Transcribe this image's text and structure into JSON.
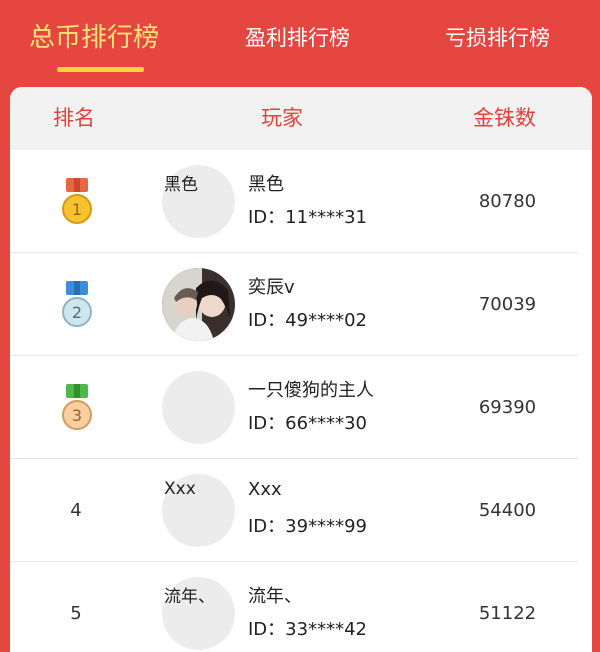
{
  "tabs": [
    {
      "label": "总币排行榜",
      "active": true
    },
    {
      "label": "盈利排行榜",
      "active": false
    },
    {
      "label": "亏损排行榜",
      "active": false
    }
  ],
  "table": {
    "headers": {
      "rank": "排名",
      "player": "玩家",
      "coins": "金铢数"
    },
    "rows": [
      {
        "rank": "1",
        "medal": "gold-medal-icon",
        "avatar_text": "黑色",
        "name": "黑色",
        "id": "ID：11****31",
        "coins": "80780"
      },
      {
        "rank": "2",
        "medal": "silver-medal-icon",
        "avatar_text": "",
        "name": "奕辰v",
        "id": "ID：49****02",
        "coins": "70039"
      },
      {
        "rank": "3",
        "medal": "bronze-medal-icon",
        "avatar_text": "",
        "name": "一只傻狗的主人",
        "id": "ID：66****30",
        "coins": "69390"
      },
      {
        "rank": "4",
        "medal": "",
        "avatar_text": "Xxx",
        "name": "Xxx",
        "id": "ID：39****99",
        "coins": "54400"
      },
      {
        "rank": "5",
        "medal": "",
        "avatar_text": "流年、",
        "name": "流年、",
        "id": "ID：33****42",
        "coins": "51122"
      }
    ]
  },
  "colors": {
    "background": "#e5463f",
    "active_tab": "#ffe27a",
    "underline": "#ffd43b",
    "header_text": "#e0433c"
  }
}
